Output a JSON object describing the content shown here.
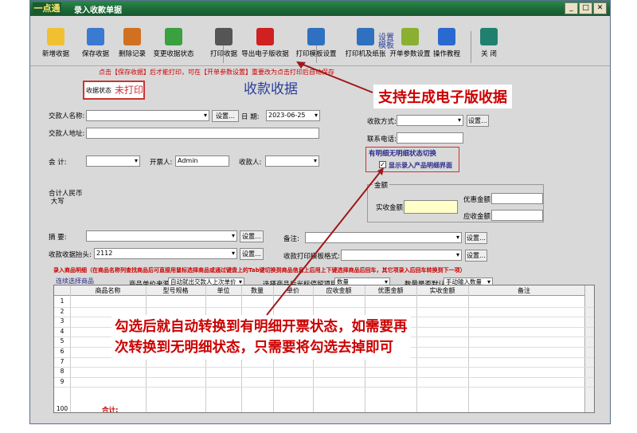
{
  "window": {
    "logo": "一点通",
    "title": "录入收款单据"
  },
  "toolbar": {
    "buttons": [
      {
        "label": "新增收据",
        "color": "#f0c030"
      },
      {
        "label": "保存收据",
        "color": "#3a7ad0"
      },
      {
        "label": "删除记录",
        "color": "#d07020"
      },
      {
        "label": "变更收据状态",
        "color": "#3aa040"
      },
      {
        "label": "打印收据",
        "color": "#555"
      },
      {
        "label": "导出电子版收据",
        "color": "#d02020"
      },
      {
        "label": "打印模板设置",
        "color": "#3070c0"
      },
      {
        "label": "打印机及纸张",
        "color": "#3070c0"
      },
      {
        "label": "开单参数设置",
        "color": "#8ab030"
      },
      {
        "label": "操作教程",
        "color": "#2a6ad0"
      },
      {
        "label": "关 闭",
        "color": "#208070"
      }
    ],
    "template_label": "设置\n模板"
  },
  "note": "点击【保存收据】后才能打印，可在【开单参数设置】重要改为点击打印后自动保存",
  "status": {
    "label": "收据状态",
    "value": "未打印"
  },
  "page_heading": "收款收据",
  "form": {
    "customer_label": "交款人名称:",
    "address_label": "交款人地址:",
    "date_label": "日 期:",
    "date_value": "2023-06-25",
    "settings_btn": "设置…",
    "payment_method_label": "收款方式:",
    "phone_label": "联系电话:",
    "accountant_label": "会 计:",
    "issuer_label": "开票人:",
    "issuer_value": "Admin",
    "payee_label": "收款人:",
    "total_label": "合计人民币\n 大写",
    "amount_group": "金额",
    "received_label": "实收金额:",
    "discount_label": "优惠金额:",
    "receivable_label": "应收金额:",
    "summary_label": "摘 要:",
    "remark_label": "备注:",
    "receipt_header_label": "收款收据抬头:",
    "receipt_header_value": "2112",
    "print_template_label": "收款打印模板格式:"
  },
  "detail_toggle": {
    "title": "有明细无明细状态切换",
    "checkbox_label": "显示录入产品明细界面",
    "checked": true
  },
  "product_section": {
    "title": "录入商品明细（在商品名称列查找商品后可直接用鼠标选择商品或通过键盘上的Tab键切换到商品信息上后用上下键选择商品后回车，其它项录入后回车转换到下一项）",
    "continuous_select": "连续选择商品",
    "price_source_label": "商品单价来源:",
    "price_source_value": "自动就出交款人上次单价",
    "stop_item_label": "选择商品后光标停留项目:",
    "stop_item_value": "数量",
    "qty_default_label": "数量是否默认:",
    "qty_default_value": "手动输入数量"
  },
  "grid": {
    "columns": [
      "商品名称",
      "型号规格",
      "单位",
      "数量",
      "单价",
      "应收金额",
      "优惠金额",
      "实收金额",
      "备注"
    ],
    "row_numbers": [
      "1",
      "2",
      "3",
      "4",
      "5",
      "6",
      "7",
      "8",
      "9",
      "100"
    ],
    "total_label": "合计:"
  },
  "annotations": {
    "top": "支持生成电子版收据",
    "bottom_line1": "勾选后就自动转换到有明细开票状态，如需要再",
    "bottom_line2": "次转换到无明细状态，只需要将勾选去掉即可"
  }
}
